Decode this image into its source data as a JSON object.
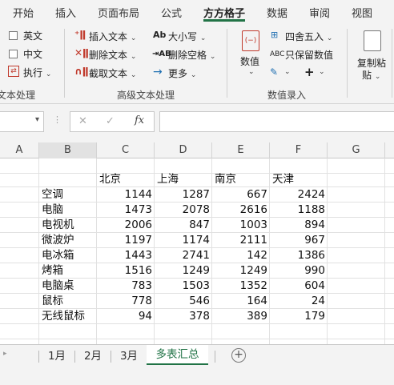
{
  "ribbon_tabs": [
    "开始",
    "插入",
    "页面布局",
    "公式",
    "方方格子",
    "数据",
    "审阅",
    "视图"
  ],
  "active_tab": "方方格子",
  "accent_color": "#217346",
  "ribbon": {
    "text_group": {
      "english": "英文",
      "chinese": "中文",
      "execute": "执行",
      "label": "文本处理"
    },
    "advanced_text": {
      "insert_text": "插入文本",
      "delete_text": "删除文本",
      "extract_text": "截取文本",
      "case": "大小写",
      "delete_space": "删除空格",
      "more": "更多",
      "label": "高级文本处理"
    },
    "numeric": {
      "numeric_label": "数值",
      "round": "四舍五入",
      "keep_numeric": "只保留数值",
      "plus": "+",
      "label": "数值录入"
    },
    "copy_paste": {
      "line1": "复制粘",
      "line2": "贴"
    }
  },
  "formula_bar": {
    "fx": "fx",
    "cancel": "✕",
    "enter": "✓",
    "value": ""
  },
  "columns": [
    "A",
    "B",
    "C",
    "D",
    "E",
    "F",
    "G"
  ],
  "selected_column": "B",
  "table": {
    "headers": [
      "北京",
      "上海",
      "南京",
      "天津"
    ],
    "rows": [
      {
        "name": "空调",
        "values": [
          1144,
          1287,
          667,
          2424
        ]
      },
      {
        "name": "电脑",
        "values": [
          1473,
          2078,
          2616,
          1188
        ]
      },
      {
        "name": "电视机",
        "values": [
          2006,
          847,
          1003,
          894
        ]
      },
      {
        "name": "微波炉",
        "values": [
          1197,
          1174,
          2111,
          967
        ]
      },
      {
        "name": "电冰箱",
        "values": [
          1443,
          2741,
          142,
          1386
        ]
      },
      {
        "name": "烤箱",
        "values": [
          1516,
          1249,
          1249,
          990
        ]
      },
      {
        "name": "电脑桌",
        "values": [
          783,
          1503,
          1352,
          604
        ]
      },
      {
        "name": "鼠标",
        "values": [
          778,
          546,
          164,
          24
        ]
      },
      {
        "name": "无线鼠标",
        "values": [
          94,
          378,
          389,
          179
        ]
      }
    ]
  },
  "sheet_tabs": [
    "1月",
    "2月",
    "3月",
    "多表汇总"
  ],
  "active_sheet": "多表汇总"
}
